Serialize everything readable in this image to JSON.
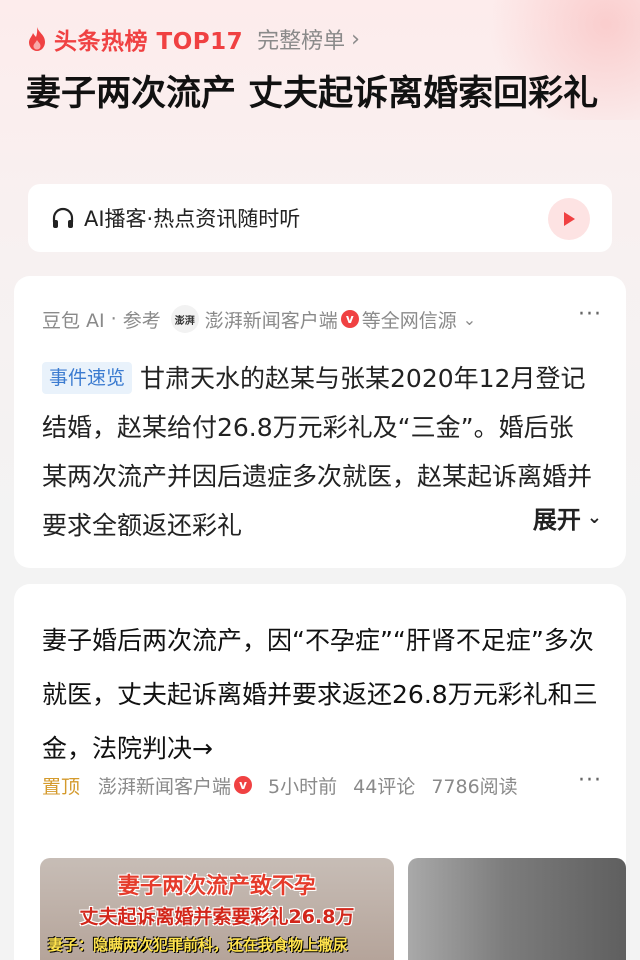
{
  "hot_header": {
    "rank_label": "头条热榜 TOP17",
    "full_list_label": "完整榜单"
  },
  "headline": "妻子两次流产 丈夫起诉离婚索回彩礼",
  "podcast": {
    "label": "AI播客·热点资讯随时听"
  },
  "ai_card": {
    "source_ai": "豆包 AI",
    "reference_label": "参考",
    "source_name": "澎湃新闻客户端",
    "sources_suffix": "等全网信源",
    "tag": "事件速览",
    "summary": "甘肃天水的赵某与张某2020年12月登记结婚，赵某给付26.8万元彩礼及“三金”。婚后张某两次流产并因后遗症多次就医，赵某起诉离婚并要求全额返还彩礼",
    "expand_label": "展开",
    "logo_text": "澎湃"
  },
  "post_card": {
    "title": "妻子婚后两次流产，因“不孕症”“肝肾不足症”多次就医，丈夫起诉离婚并要求返还26.8万元彩礼和三金，法院判决→",
    "pinned_label": "置顶",
    "source": "澎湃新闻客户端",
    "time": "5小时前",
    "comments": "44评论",
    "reads": "7786阅读",
    "thumb_line1": "妻子两次流产致不孕",
    "thumb_line2": "丈夫起诉离婚并索要彩礼26.8万",
    "thumb_line3": "妻子：隐瞒两次犯罪前科，还在我食物上撒尿"
  },
  "icons": {
    "flame": "flame-icon",
    "chevron_right": "chevron-right-icon",
    "headphones": "headphones-icon",
    "play": "play-icon",
    "verified": "verified-icon",
    "more": "more-icon"
  },
  "colors": {
    "accent_red": "#f04142",
    "tag_blue": "#3b7bd0",
    "pinned_gold": "#d49a2c"
  }
}
